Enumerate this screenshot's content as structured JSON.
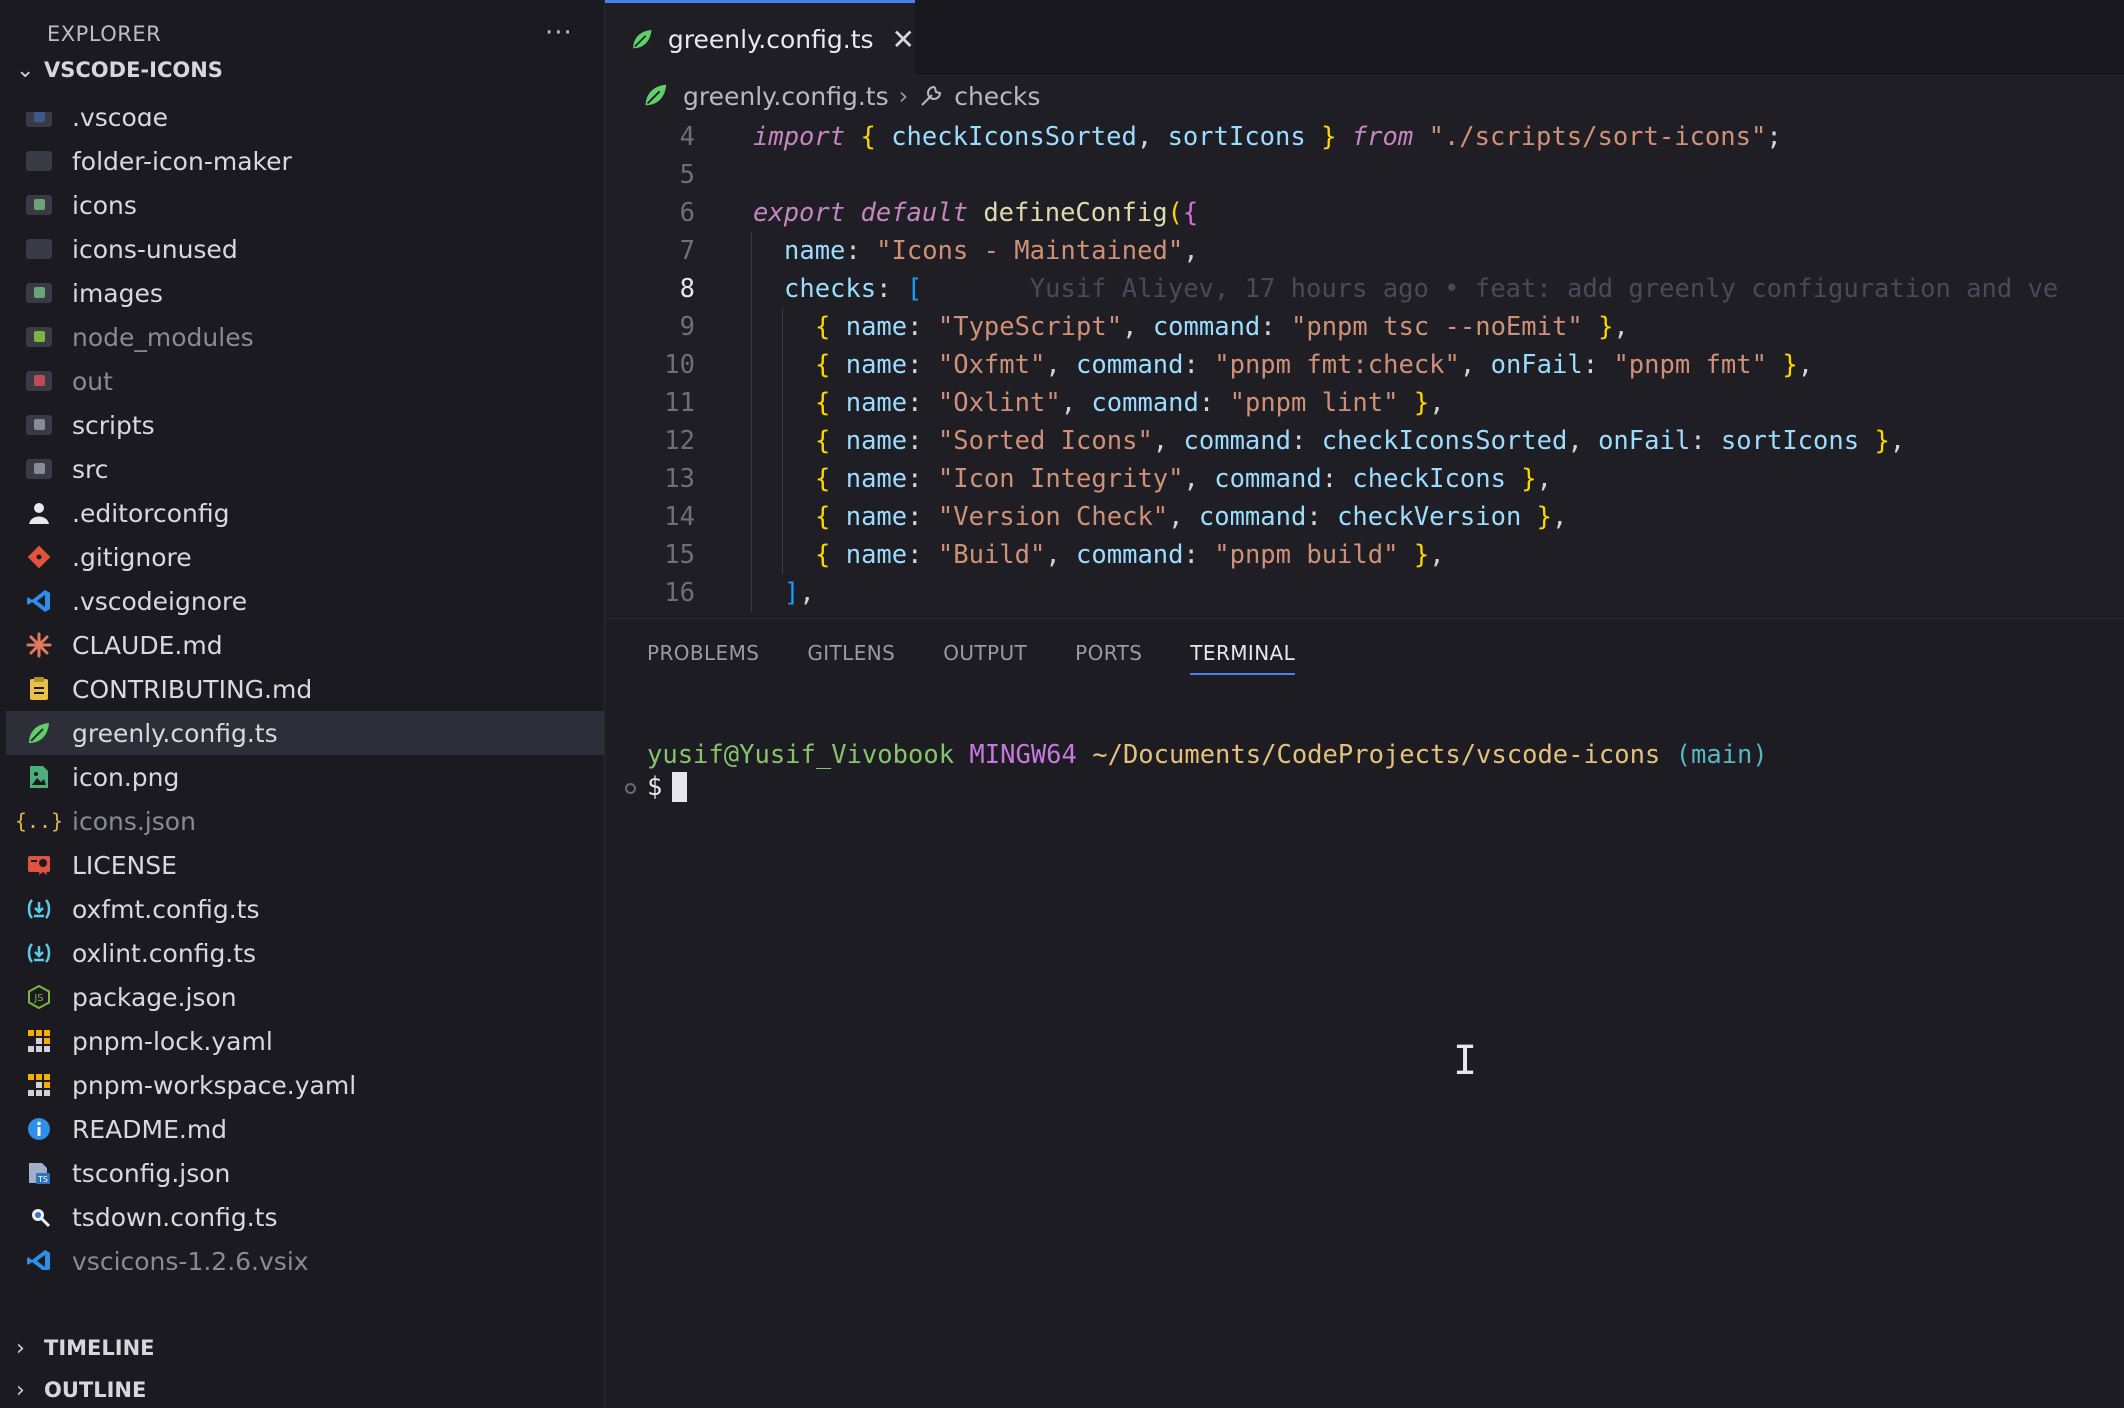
{
  "sidebar": {
    "header": "EXPLORER",
    "more": "···",
    "root": "VSCODE-ICONS",
    "items": [
      {
        "label": ".vscode",
        "kind": "folder",
        "icon": "folder-vscode-icon",
        "color": "#3a5a8c"
      },
      {
        "label": "folder-icon-maker",
        "kind": "folder",
        "icon": "folder-icon"
      },
      {
        "label": "icons",
        "kind": "folder",
        "icon": "folder-images-icon",
        "color": "#6aa37a"
      },
      {
        "label": "icons-unused",
        "kind": "folder",
        "icon": "folder-icon"
      },
      {
        "label": "images",
        "kind": "folder",
        "icon": "folder-images-icon",
        "color": "#6aa37a"
      },
      {
        "label": "node_modules",
        "kind": "folder",
        "icon": "folder-node-icon",
        "color": "#7cb342",
        "dim": true
      },
      {
        "label": "out",
        "kind": "folder",
        "icon": "folder-out-icon",
        "color": "#c14a5a",
        "dim": true
      },
      {
        "label": "scripts",
        "kind": "folder",
        "icon": "folder-scripts-icon",
        "color": "#8a8a96"
      },
      {
        "label": "src",
        "kind": "folder",
        "icon": "folder-src-icon",
        "color": "#8a8a96"
      },
      {
        "label": ".editorconfig",
        "kind": "file",
        "icon": "editorconfig-icon"
      },
      {
        "label": ".gitignore",
        "kind": "file",
        "icon": "git-icon"
      },
      {
        "label": ".vscodeignore",
        "kind": "file",
        "icon": "vscode-icon"
      },
      {
        "label": "CLAUDE.md",
        "kind": "file",
        "icon": "claude-icon"
      },
      {
        "label": "CONTRIBUTING.md",
        "kind": "file",
        "icon": "contributing-icon"
      },
      {
        "label": "greenly.config.ts",
        "kind": "file",
        "icon": "greenly-leaf-icon",
        "selected": true
      },
      {
        "label": "icon.png",
        "kind": "file",
        "icon": "image-file-icon"
      },
      {
        "label": "icons.json",
        "kind": "file",
        "icon": "json-icon",
        "dim": true
      },
      {
        "label": "LICENSE",
        "kind": "file",
        "icon": "license-icon"
      },
      {
        "label": "oxfmt.config.ts",
        "kind": "file",
        "icon": "oxc-icon"
      },
      {
        "label": "oxlint.config.ts",
        "kind": "file",
        "icon": "oxc-icon"
      },
      {
        "label": "package.json",
        "kind": "file",
        "icon": "nodejs-icon"
      },
      {
        "label": "pnpm-lock.yaml",
        "kind": "file",
        "icon": "pnpm-icon"
      },
      {
        "label": "pnpm-workspace.yaml",
        "kind": "file",
        "icon": "pnpm-icon"
      },
      {
        "label": "README.md",
        "kind": "file",
        "icon": "info-icon"
      },
      {
        "label": "tsconfig.json",
        "kind": "file",
        "icon": "tsconfig-icon"
      },
      {
        "label": "tsdown.config.ts",
        "kind": "file",
        "icon": "tsdown-icon"
      },
      {
        "label": "vscicons-1.2.6.vsix",
        "kind": "file",
        "icon": "vscode-icon",
        "dim": true
      }
    ],
    "sections": {
      "timeline": "TIMELINE",
      "outline": "OUTLINE"
    }
  },
  "editor": {
    "tab": {
      "label": "greenly.config.ts",
      "close": "✕"
    },
    "breadcrumb": {
      "file": "greenly.config.ts",
      "sep": "›",
      "symbol": "checks"
    },
    "current_line": 8,
    "lines": [
      {
        "n": "4",
        "indent": 0,
        "tokens": [
          [
            "k-imp",
            "import"
          ],
          [
            "punc",
            " "
          ],
          [
            "br1",
            "{"
          ],
          [
            "punc",
            " "
          ],
          [
            "id",
            "checkIconsSorted"
          ],
          [
            "punc",
            ", "
          ],
          [
            "id",
            "sortIcons"
          ],
          [
            "punc",
            " "
          ],
          [
            "br1",
            "}"
          ],
          [
            "punc",
            " "
          ],
          [
            "k-imp",
            "from"
          ],
          [
            "punc",
            " "
          ],
          [
            "str",
            "\"./scripts/sort-icons\""
          ],
          [
            "punc",
            ";"
          ]
        ]
      },
      {
        "n": "5",
        "indent": 0,
        "tokens": []
      },
      {
        "n": "6",
        "indent": 0,
        "tokens": [
          [
            "k-exp",
            "export"
          ],
          [
            "punc",
            " "
          ],
          [
            "k-exp",
            "default"
          ],
          [
            "punc",
            " "
          ],
          [
            "fn",
            "defineConfig"
          ],
          [
            "br1",
            "("
          ],
          [
            "br2",
            "{"
          ]
        ]
      },
      {
        "n": "7",
        "indent": 1,
        "tokens": [
          [
            "id",
            "name"
          ],
          [
            "punc",
            ": "
          ],
          [
            "str",
            "\"Icons - Maintained\""
          ],
          [
            "punc",
            ","
          ]
        ]
      },
      {
        "n": "8",
        "indent": 1,
        "tokens": [
          [
            "id",
            "checks"
          ],
          [
            "punc",
            ": "
          ],
          [
            "br3",
            "["
          ],
          [
            "blame",
            "       Yusif Aliyev, 17 hours ago • feat: add greenly configuration and ve"
          ]
        ]
      },
      {
        "n": "9",
        "indent": 2,
        "tokens": [
          [
            "br1",
            "{"
          ],
          [
            "punc",
            " "
          ],
          [
            "id",
            "name"
          ],
          [
            "punc",
            ": "
          ],
          [
            "str",
            "\"TypeScript\""
          ],
          [
            "punc",
            ", "
          ],
          [
            "id",
            "command"
          ],
          [
            "punc",
            ": "
          ],
          [
            "str",
            "\"pnpm tsc --noEmit\""
          ],
          [
            "punc",
            " "
          ],
          [
            "br1",
            "}"
          ],
          [
            "punc",
            ","
          ]
        ]
      },
      {
        "n": "10",
        "indent": 2,
        "tokens": [
          [
            "br1",
            "{"
          ],
          [
            "punc",
            " "
          ],
          [
            "id",
            "name"
          ],
          [
            "punc",
            ": "
          ],
          [
            "str",
            "\"Oxfmt\""
          ],
          [
            "punc",
            ", "
          ],
          [
            "id",
            "command"
          ],
          [
            "punc",
            ": "
          ],
          [
            "str",
            "\"pnpm fmt:check\""
          ],
          [
            "punc",
            ", "
          ],
          [
            "id",
            "onFail"
          ],
          [
            "punc",
            ": "
          ],
          [
            "str",
            "\"pnpm fmt\""
          ],
          [
            "punc",
            " "
          ],
          [
            "br1",
            "}"
          ],
          [
            "punc",
            ","
          ]
        ]
      },
      {
        "n": "11",
        "indent": 2,
        "tokens": [
          [
            "br1",
            "{"
          ],
          [
            "punc",
            " "
          ],
          [
            "id",
            "name"
          ],
          [
            "punc",
            ": "
          ],
          [
            "str",
            "\"Oxlint\""
          ],
          [
            "punc",
            ", "
          ],
          [
            "id",
            "command"
          ],
          [
            "punc",
            ": "
          ],
          [
            "str",
            "\"pnpm lint\""
          ],
          [
            "punc",
            " "
          ],
          [
            "br1",
            "}"
          ],
          [
            "punc",
            ","
          ]
        ]
      },
      {
        "n": "12",
        "indent": 2,
        "tokens": [
          [
            "br1",
            "{"
          ],
          [
            "punc",
            " "
          ],
          [
            "id",
            "name"
          ],
          [
            "punc",
            ": "
          ],
          [
            "str",
            "\"Sorted Icons\""
          ],
          [
            "punc",
            ", "
          ],
          [
            "id",
            "command"
          ],
          [
            "punc",
            ": "
          ],
          [
            "id",
            "checkIconsSorted"
          ],
          [
            "punc",
            ", "
          ],
          [
            "id",
            "onFail"
          ],
          [
            "punc",
            ": "
          ],
          [
            "id",
            "sortIcons"
          ],
          [
            "punc",
            " "
          ],
          [
            "br1",
            "}"
          ],
          [
            "punc",
            ","
          ]
        ]
      },
      {
        "n": "13",
        "indent": 2,
        "tokens": [
          [
            "br1",
            "{"
          ],
          [
            "punc",
            " "
          ],
          [
            "id",
            "name"
          ],
          [
            "punc",
            ": "
          ],
          [
            "str",
            "\"Icon Integrity\""
          ],
          [
            "punc",
            ", "
          ],
          [
            "id",
            "command"
          ],
          [
            "punc",
            ": "
          ],
          [
            "id",
            "checkIcons"
          ],
          [
            "punc",
            " "
          ],
          [
            "br1",
            "}"
          ],
          [
            "punc",
            ","
          ]
        ]
      },
      {
        "n": "14",
        "indent": 2,
        "tokens": [
          [
            "br1",
            "{"
          ],
          [
            "punc",
            " "
          ],
          [
            "id",
            "name"
          ],
          [
            "punc",
            ": "
          ],
          [
            "str",
            "\"Version Check\""
          ],
          [
            "punc",
            ", "
          ],
          [
            "id",
            "command"
          ],
          [
            "punc",
            ": "
          ],
          [
            "id",
            "checkVersion"
          ],
          [
            "punc",
            " "
          ],
          [
            "br1",
            "}"
          ],
          [
            "punc",
            ","
          ]
        ]
      },
      {
        "n": "15",
        "indent": 2,
        "tokens": [
          [
            "br1",
            "{"
          ],
          [
            "punc",
            " "
          ],
          [
            "id",
            "name"
          ],
          [
            "punc",
            ": "
          ],
          [
            "str",
            "\"Build\""
          ],
          [
            "punc",
            ", "
          ],
          [
            "id",
            "command"
          ],
          [
            "punc",
            ": "
          ],
          [
            "str",
            "\"pnpm build\""
          ],
          [
            "punc",
            " "
          ],
          [
            "br1",
            "}"
          ],
          [
            "punc",
            ","
          ]
        ]
      },
      {
        "n": "16",
        "indent": 1,
        "tokens": [
          [
            "br3",
            "]"
          ],
          [
            "punc",
            ","
          ]
        ]
      }
    ]
  },
  "panel": {
    "tabs": [
      {
        "label": "PROBLEMS",
        "active": false
      },
      {
        "label": "GITLENS",
        "active": false
      },
      {
        "label": "OUTPUT",
        "active": false
      },
      {
        "label": "PORTS",
        "active": false
      },
      {
        "label": "TERMINAL",
        "active": true
      }
    ],
    "terminal": {
      "user": "yusif@Yusif_Vivobook",
      "host": "MINGW64",
      "path": "~/Documents/CodeProjects/vscode-icons",
      "branch": "(main)",
      "prompt": "$"
    }
  },
  "colors": {
    "accent": "#4c7ff0",
    "leaf": "#5fcf6a"
  }
}
